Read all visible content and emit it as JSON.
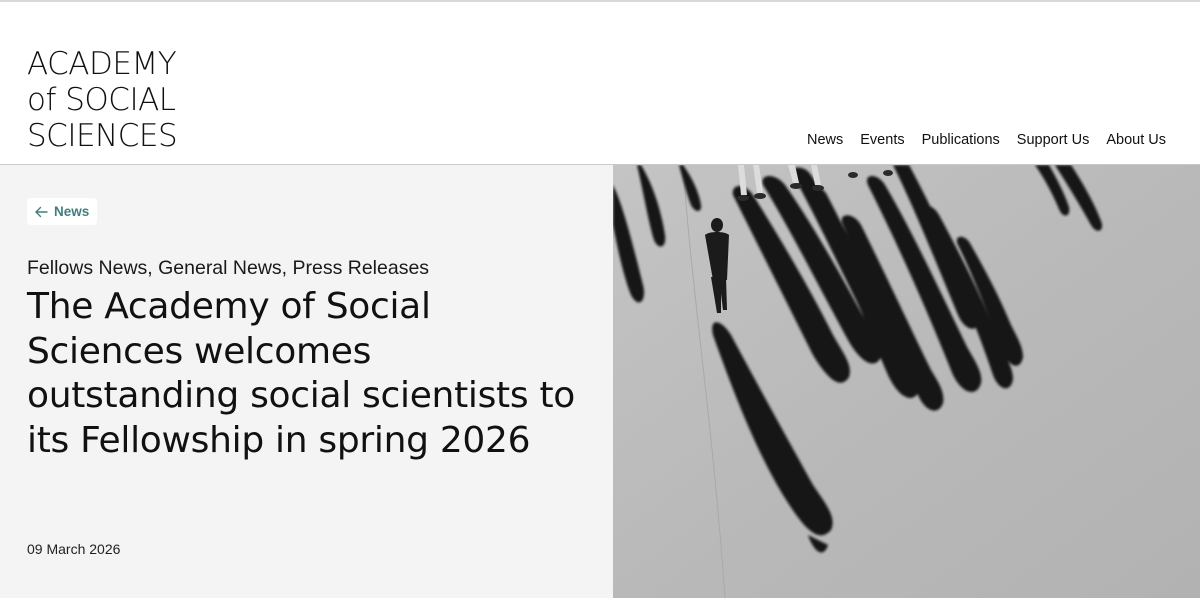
{
  "logo": {
    "line1": "ACADEMY",
    "line2": "of SOCIAL",
    "line3": "SCIENCES"
  },
  "nav": {
    "items": [
      "News",
      "Events",
      "Publications",
      "Support Us",
      "About Us"
    ]
  },
  "article": {
    "back_label": "News",
    "categories": "Fellows News, General News, Press Releases",
    "title": "The Academy of Social Sciences welcomes outstanding social scientists to its Fellowship in spring 2026",
    "date": "09 March 2026"
  },
  "colors": {
    "accent": "#3f7f7f",
    "panel_bg": "#f4f4f4"
  },
  "icons": {
    "back": "arrow-left-icon"
  }
}
